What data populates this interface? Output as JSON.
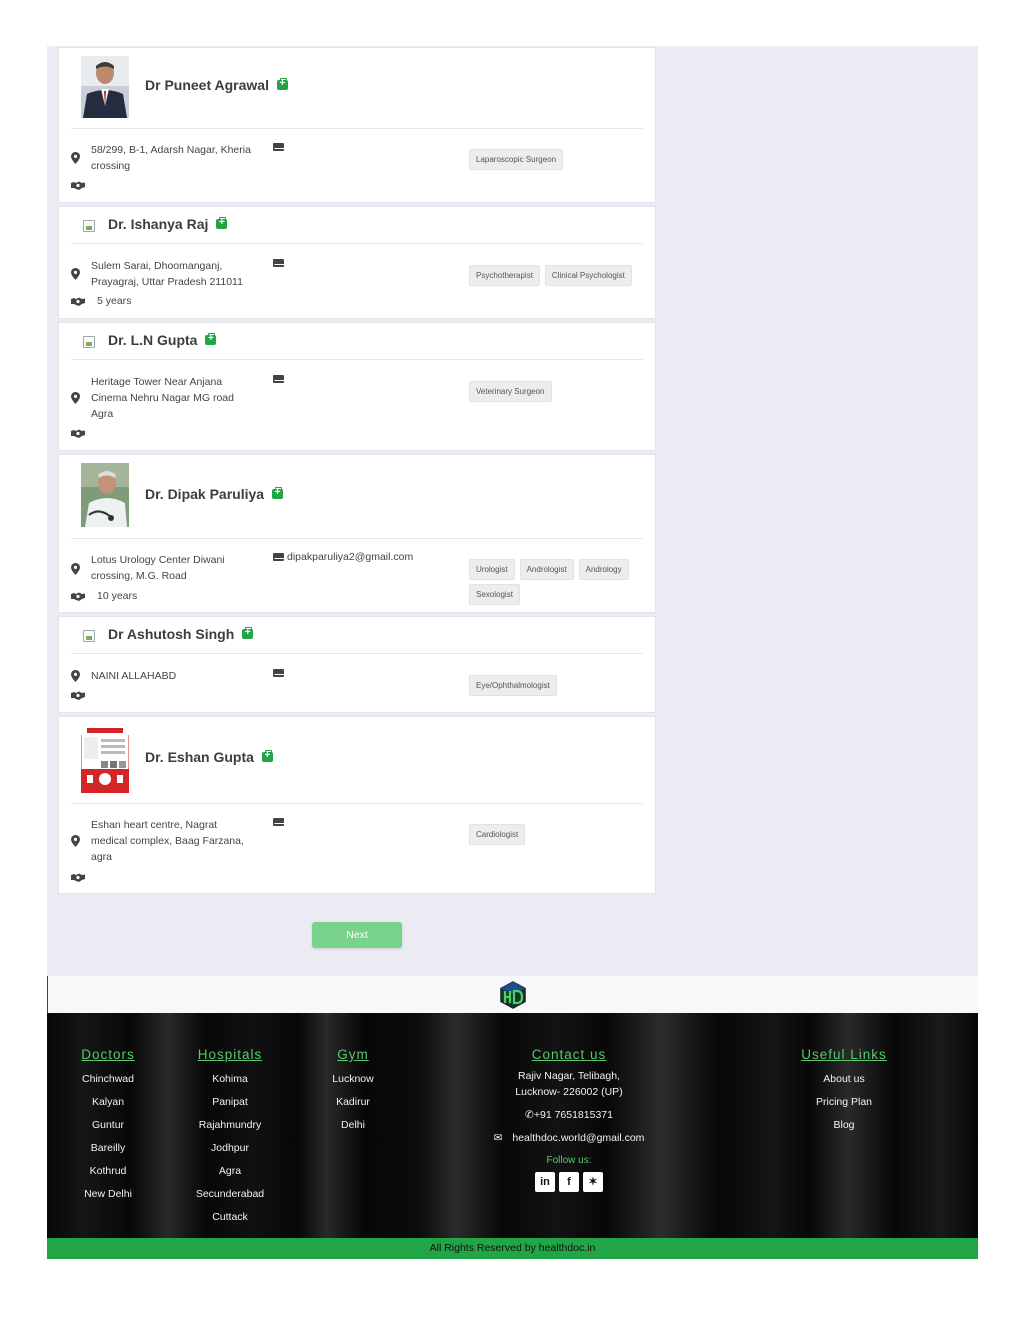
{
  "doctors": [
    {
      "name": "Dr Puneet Agrawal",
      "address": "58/299, B-1, Adarsh Nagar, Kheria crossing",
      "experience": "",
      "email": "",
      "tags": [
        "Laparoscopic Surgeon"
      ]
    },
    {
      "name": "Dr. Ishanya Raj",
      "address": "Sulem Sarai, Dhoomanganj, Prayagraj, Uttar Pradesh 211011",
      "experience": "5 years",
      "email": "",
      "tags": [
        "Psychotherapist",
        "Clinical Psychologist"
      ]
    },
    {
      "name": "Dr. L.N Gupta",
      "address": "Heritage Tower Near Anjana Cinema Nehru Nagar MG road Agra",
      "experience": "",
      "email": "",
      "tags": [
        "Veterinary Surgeon"
      ]
    },
    {
      "name": "Dr. Dipak Paruliya",
      "address": "Lotus Urology Center Diwani crossing, M.G. Road",
      "experience": "10 years",
      "email": "dipakparuliya2@gmail.com",
      "tags": [
        "Urologist",
        "Andrologist",
        "Andrology",
        "Sexologist"
      ]
    },
    {
      "name": "Dr Ashutosh Singh",
      "address": "NAINI ALLAHABD",
      "experience": "",
      "email": "",
      "tags": [
        "Eye/Ophthalmologist"
      ]
    },
    {
      "name": "Dr. Eshan Gupta",
      "address": "Eshan heart centre, Nagrat medical complex, Baag Farzana, agra",
      "experience": "",
      "email": "",
      "tags": [
        "Cardiologist"
      ]
    }
  ],
  "pagination": {
    "next_label": "Next"
  },
  "footer": {
    "doctors": {
      "title": "Doctors",
      "links": [
        "Chinchwad",
        "Kalyan",
        "Guntur",
        "Bareilly",
        "Kothrud",
        "New Delhi"
      ]
    },
    "hospitals": {
      "title": "Hospitals",
      "links": [
        "Kohima",
        "Panipat",
        "Rajahmundry",
        "Jodhpur",
        "Agra",
        "Secunderabad",
        "Cuttack"
      ]
    },
    "gym": {
      "title": "Gym",
      "links": [
        "Lucknow",
        "Kadirur",
        "Delhi"
      ]
    },
    "contact": {
      "title": "Contact us",
      "address_line1": "Rajiv Nagar, Telibagh,",
      "address_line2": "Lucknow- 226002 (UP)",
      "phone": "+91 7651815371",
      "email": "healthdoc.world@gmail.com",
      "follow_label": "Follow us:"
    },
    "useful": {
      "title": "Useful Links",
      "links": [
        "About us",
        "Pricing Plan",
        "Blog"
      ]
    },
    "copyright": "All Rights Reserved by healthdoc.in"
  },
  "colors": {
    "accent_green": "#22a546",
    "heading_green": "#59c86c",
    "button_green": "#79d38d"
  },
  "icons": [
    "verified-icon",
    "location-pin-icon",
    "handshake-icon",
    "envelope-icon",
    "phone-icon",
    "linkedin-icon",
    "facebook-icon",
    "twitter-icon",
    "healthdoc-logo"
  ]
}
